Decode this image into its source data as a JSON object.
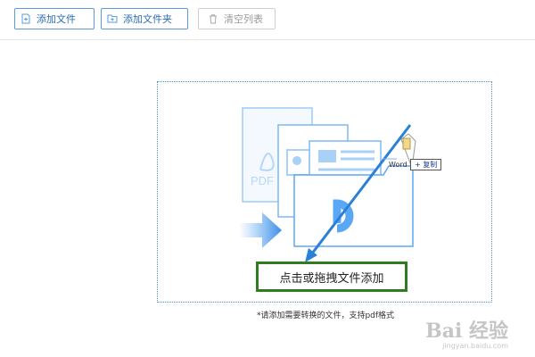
{
  "toolbar": {
    "add_file": "添加文件",
    "add_folder": "添加文件夹",
    "clear_list": "清空列表"
  },
  "dropzone": {
    "cta_text": "点击或拖拽文件添加",
    "hint": "*请添加需要转换的文件，支持pdf格式",
    "pdf_label": "PDF",
    "word_label": "Word",
    "copy_badge": "+ 复制"
  },
  "watermark": {
    "main": "Bai 经验",
    "sub": "jingyan.baidu.com"
  },
  "colors": {
    "accent": "#2b8be6",
    "cta_border": "#2f7d1f",
    "illustration": "#5aa8f5"
  },
  "icons": {
    "add_file": "file-plus-icon",
    "add_folder": "folder-plus-icon",
    "clear_list": "trash-icon"
  }
}
